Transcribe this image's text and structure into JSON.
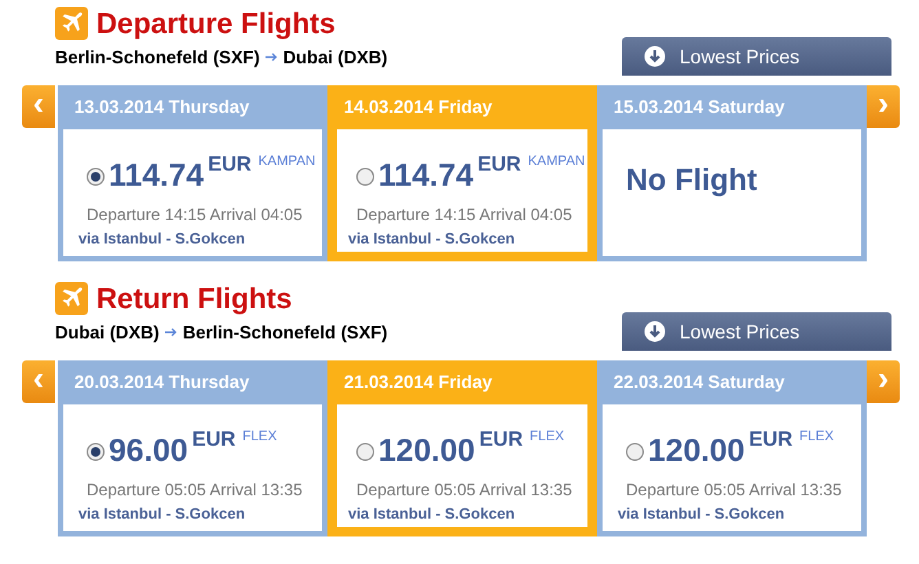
{
  "sections": [
    {
      "title": "Departure Flights",
      "route": {
        "from": "Berlin-Schonefeld (SXF)",
        "to": "Dubai (DXB)"
      },
      "lowest_prices_button": "Lowest Prices",
      "prev_arrow": "‹",
      "next_arrow": "›",
      "days": [
        {
          "kind": "flight",
          "date": "13.03.2014 Thursday",
          "highlighted": false,
          "selected": true,
          "price": "114.74",
          "currency": "EUR",
          "fare": "KAMPAN",
          "times": "Departure 14:15 Arrival 04:05",
          "via": "via Istanbul - S.Gokcen"
        },
        {
          "kind": "flight",
          "date": "14.03.2014 Friday",
          "highlighted": true,
          "selected": false,
          "price": "114.74",
          "currency": "EUR",
          "fare": "KAMPAN",
          "times": "Departure 14:15 Arrival 04:05",
          "via": "via Istanbul - S.Gokcen"
        },
        {
          "kind": "none",
          "date": "15.03.2014 Saturday",
          "highlighted": false,
          "message": "No Flight"
        }
      ]
    },
    {
      "title": "Return Flights",
      "route": {
        "from": "Dubai (DXB)",
        "to": "Berlin-Schonefeld (SXF)"
      },
      "lowest_prices_button": "Lowest Prices",
      "prev_arrow": "‹",
      "next_arrow": "›",
      "days": [
        {
          "kind": "flight",
          "date": "20.03.2014 Thursday",
          "highlighted": false,
          "selected": true,
          "price": "96.00",
          "currency": "EUR",
          "fare": "FLEX",
          "times": "Departure 05:05 Arrival 13:35",
          "via": "via Istanbul - S.Gokcen"
        },
        {
          "kind": "flight",
          "date": "21.03.2014 Friday",
          "highlighted": true,
          "selected": false,
          "price": "120.00",
          "currency": "EUR",
          "fare": "FLEX",
          "times": "Departure 05:05 Arrival 13:35",
          "via": "via Istanbul - S.Gokcen"
        },
        {
          "kind": "flight",
          "date": "22.03.2014 Saturday",
          "highlighted": false,
          "selected": false,
          "price": "120.00",
          "currency": "EUR",
          "fare": "FLEX",
          "times": "Departure 05:05 Arrival 13:35",
          "via": "via Istanbul - S.Gokcen"
        }
      ]
    }
  ]
}
